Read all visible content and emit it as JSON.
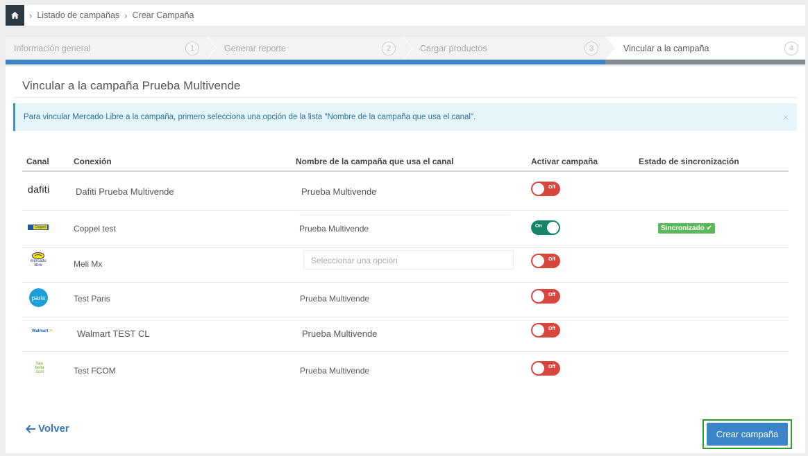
{
  "breadcrumb": {
    "items": [
      "Listado de campañas",
      "Crear Campaña"
    ]
  },
  "steps": [
    {
      "label": "Información general",
      "number": "1",
      "active": false
    },
    {
      "label": "Generar reporte",
      "number": "2",
      "active": false
    },
    {
      "label": "Cargar productos",
      "number": "3",
      "active": false
    },
    {
      "label": "Vincular a la campaña",
      "number": "4",
      "active": true
    }
  ],
  "page": {
    "title": "Vincular a la campaña Prueba Multivende"
  },
  "alert": {
    "text": "Para vincular Mercado Libre a la campaña, primero selecciona una opción de la lista \"Nombre de la campaña que usa el canal\".",
    "close": "×"
  },
  "table": {
    "headers": [
      "Canal",
      "Conexión",
      "Nombre de la campaña que usa el canal",
      "Activar campaña",
      "Estado de sincronización"
    ],
    "rows": [
      {
        "logo": "dafiti",
        "connection": "Dafiti Prueba Multivende",
        "campaign": "Prueba Multivende",
        "toggle": "Off",
        "status": ""
      },
      {
        "logo": "Coppel",
        "connection": "Coppel test",
        "campaign": "Prueba Multivende",
        "toggle": "On",
        "status": "Sincronizado ✔"
      },
      {
        "logo": "mercado libre",
        "connection": "Meli Mx",
        "campaign": "",
        "placeholder": "Seleccionar una opción",
        "toggle": "Off",
        "status": ""
      },
      {
        "logo": "paris",
        "connection": "Test Paris",
        "campaign": "Prueba Multivende",
        "toggle": "Off",
        "status": ""
      },
      {
        "logo": "Walmart",
        "connection": "Walmart TEST CL",
        "campaign": "Prueba Multivende",
        "toggle": "Off",
        "status": ""
      },
      {
        "logo": "fala bella .com",
        "connection": "Test FCOM",
        "campaign": "Prueba Multivende",
        "toggle": "Off",
        "status": ""
      }
    ]
  },
  "footer": {
    "back_label": "Volver",
    "create_label": "Crear campaña"
  },
  "colors": {
    "accent_blue": "#3f84c6",
    "toggle_off": "#d9463e",
    "toggle_on": "#15856a",
    "synced_badge": "#5bb95b",
    "highlight_border": "#2f9d2b"
  }
}
